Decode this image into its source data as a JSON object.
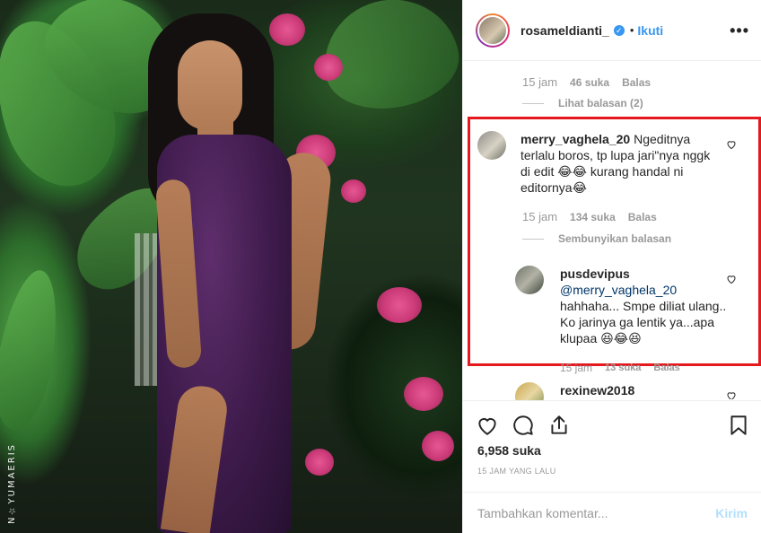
{
  "photo": {
    "watermark": "N☆YUMAERIS"
  },
  "header": {
    "username": "rosameldianti_",
    "verified_icon": "verified-badge-icon",
    "separator": "•",
    "follow_label": "Ikuti",
    "more_icon": "more-options-icon"
  },
  "thread_top": {
    "time": "15 jam",
    "likes": "46 suka",
    "reply": "Balas",
    "view_replies": "Lihat balasan (2)"
  },
  "comment1": {
    "username": "merry_vaghela_20",
    "text": "Ngeditnya terlalu boros, tp lupa jari\"nya nggk di edit 😂😂 kurang handal ni editornya😂",
    "time": "15 jam",
    "likes": "134 suka",
    "reply": "Balas",
    "hide_replies": "Sembunyikan balasan"
  },
  "comment2": {
    "username": "pusdevipus",
    "mention": "@merry_vaghela_20",
    "text": "hahhaha... Smpe diliat ulang.. Ko jarinya ga lentik ya...apa klupaa 😆😂😆"
  },
  "comment2_meta": {
    "time": "15 jam",
    "likes": "13 suka",
    "reply": "Balas"
  },
  "comment3": {
    "username": "rexinew2018"
  },
  "actions": {
    "like_icon": "heart-icon",
    "comment_icon": "comment-icon",
    "share_icon": "share-icon",
    "save_icon": "bookmark-icon",
    "likes_count": "6,958 suka",
    "time_ago": "15 JAM YANG LALU"
  },
  "compose": {
    "placeholder": "Tambahkan komentar...",
    "send_label": "Kirim"
  },
  "colors": {
    "highlight_border": "#e5181e",
    "link_blue": "#3897f0",
    "muted": "#999999"
  }
}
